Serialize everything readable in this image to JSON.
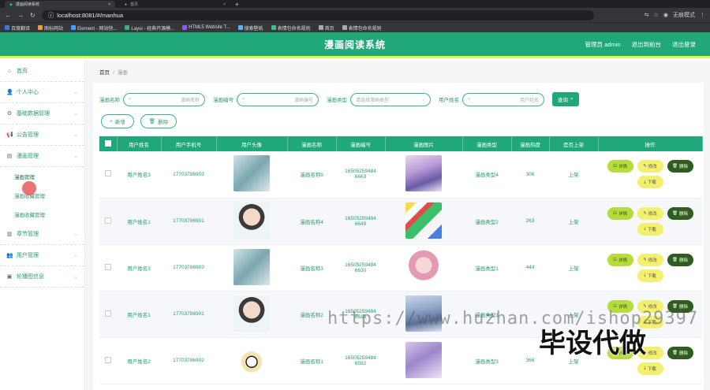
{
  "browser": {
    "tabs": [
      {
        "label": "漫画阅读系统"
      },
      {
        "label": "首页"
      }
    ],
    "new_tab": "+",
    "url": "localhost:8081/#/manhua",
    "profile": "无痕模式",
    "bookmarks": [
      {
        "label": "百度翻译",
        "color": "#3a7bd5"
      },
      {
        "label": "图标网站",
        "color": "#e8a23a"
      },
      {
        "label": "Element - 网站快...",
        "color": "#409eff"
      },
      {
        "label": "Layui - 经典开源模...",
        "color": "#2fb57d"
      },
      {
        "label": "HTML5 Website T...",
        "color": "#8a5cf6"
      },
      {
        "label": "搜索壁纸",
        "color": "#5ab0ff"
      },
      {
        "label": "表情包命名规则",
        "color": "#3fbf7f"
      },
      {
        "label": "首页",
        "color": "#aaaaaa"
      },
      {
        "label": "表情包命名规则",
        "color": "#aaaaaa"
      }
    ]
  },
  "header": {
    "title": "漫画阅读系统",
    "links": [
      "管理员 admin",
      "退出到前台",
      "退出登录"
    ]
  },
  "sidebar": {
    "items": [
      {
        "label": "首页",
        "icon": "home-icon",
        "chevron": false
      },
      {
        "label": "个人中心",
        "icon": "user-icon",
        "chevron": true
      },
      {
        "label": "基础数据管理",
        "icon": "settings-icon",
        "chevron": true
      },
      {
        "label": "公告管理",
        "icon": "megaphone-icon",
        "chevron": true
      },
      {
        "label": "漫画管理",
        "icon": "book-icon",
        "chevron": true
      }
    ],
    "subitems": [
      {
        "label": "漫画管理"
      },
      {
        "label": "漫画收藏管理"
      },
      {
        "label": "漫画收藏管理"
      }
    ],
    "items2": [
      {
        "label": "章节管理",
        "icon": "chapter-icon",
        "chevron": true
      },
      {
        "label": "用户管理",
        "icon": "users-icon",
        "chevron": true
      },
      {
        "label": "轮播图信息",
        "icon": "image-icon",
        "chevron": true
      }
    ]
  },
  "breadcrumb": {
    "home": "首页",
    "sep": "/",
    "current": "漫画"
  },
  "search": {
    "name_label": "漫画名称",
    "name_placeholder": "漫画名称",
    "code_label": "漫画编号",
    "code_placeholder": "漫画编号",
    "type_label": "漫画类型",
    "type_placeholder": "请选择漫画类型",
    "user_label": "用户姓名",
    "user_placeholder": "用户姓名",
    "button": "查询"
  },
  "actions": {
    "add": "新增",
    "delete": "删除"
  },
  "table": {
    "headers": [
      "",
      "用户姓名",
      "用户手机号",
      "用户头像",
      "漫画名称",
      "漫画编号",
      "漫画图片",
      "漫画类型",
      "漫画热度",
      "是否上架",
      "操作"
    ],
    "rows": [
      {
        "user": "用户姓名3",
        "phone": "17703786903",
        "avatar": "av1",
        "name": "漫画名称5",
        "code1": "16505259484",
        "code2": "6663",
        "img": "mg1",
        "type": "漫画类型4",
        "hot": "306",
        "shelf": "上架"
      },
      {
        "user": "用户姓名1",
        "phone": "17703786901",
        "avatar": "av2",
        "name": "漫画名称4",
        "code1": "16505259484",
        "code2": "6649",
        "img": "mg2",
        "type": "漫画类型2",
        "hot": "263",
        "shelf": "上架"
      },
      {
        "user": "用户姓名3",
        "phone": "17703786903",
        "avatar": "av1",
        "name": "漫画名称3",
        "code1": "16505259484",
        "code2": "6630",
        "img": "mg3",
        "type": "漫画类型1",
        "hot": "444",
        "shelf": "上架"
      },
      {
        "user": "用户姓名1",
        "phone": "17703786901",
        "avatar": "av2",
        "name": "漫画名称2",
        "code1": "16505259484",
        "code2": "6615",
        "img": "mg4",
        "type": "漫画类型1",
        "hot": "",
        "shelf": "上架"
      },
      {
        "user": "用户姓名2",
        "phone": "17703786902",
        "avatar": "av3",
        "name": "漫画名称1",
        "code1": "16505259484",
        "code2": "6592",
        "img": "mg5",
        "type": "漫画类型3",
        "hot": "366",
        "shelf": "上架"
      }
    ],
    "op_labels": {
      "detail": "详情",
      "edit": "修改",
      "delete": "删除",
      "download": "下载"
    }
  },
  "watermarks": {
    "url": "https://www.huzhan.com/ishop29397",
    "brand": "毕设代做"
  }
}
